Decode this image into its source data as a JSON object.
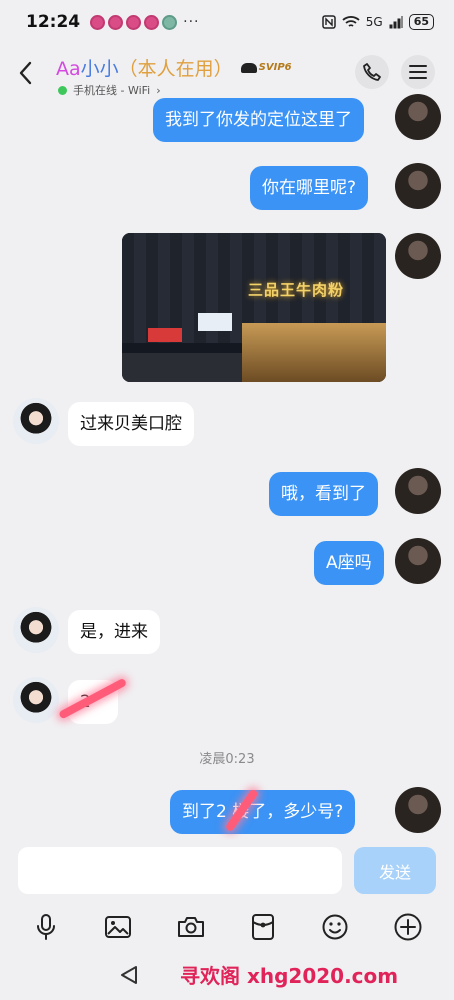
{
  "status_bar": {
    "time": "12:24",
    "dots": "···",
    "signal": "5G",
    "battery": "65"
  },
  "header": {
    "name_part1": "Aa",
    "name_part2": "小小",
    "name_part3": "（本人在用）",
    "svip": "SVIP6",
    "online_status": "手机在线 - WiFi",
    "online_arrow": "›"
  },
  "messages": [
    {
      "sender": "me",
      "type": "text",
      "text": "我到了你发的定位这里了"
    },
    {
      "sender": "me",
      "type": "text",
      "text": "你在哪里呢?"
    },
    {
      "sender": "me",
      "type": "image",
      "caption_in_image": "三品王牛肉粉"
    },
    {
      "sender": "other",
      "type": "text",
      "text": "过来贝美口腔"
    },
    {
      "sender": "me",
      "type": "text",
      "text": "哦，看到了"
    },
    {
      "sender": "me",
      "type": "text",
      "text": "A座吗"
    },
    {
      "sender": "other",
      "type": "text",
      "text": "是，进来"
    },
    {
      "sender": "other",
      "type": "text",
      "text": "2"
    },
    {
      "sender": "me",
      "type": "text",
      "text": "到了2 楼了，多少号?"
    }
  ],
  "time_divider": "凌晨0:23",
  "input": {
    "placeholder": "",
    "send_label": "发送"
  },
  "toolbar_icons": [
    "microphone-icon",
    "image-icon",
    "camera-icon",
    "red-packet-icon",
    "emoji-icon",
    "plus-icon"
  ],
  "watermark": "寻欢阁 xhg2020.com",
  "colors": {
    "my_bubble": "#3b93f5",
    "other_bubble": "#ffffff",
    "send_button": "#a8d2fa",
    "online_dot": "#3fc75c",
    "watermark": "#e0245a"
  }
}
